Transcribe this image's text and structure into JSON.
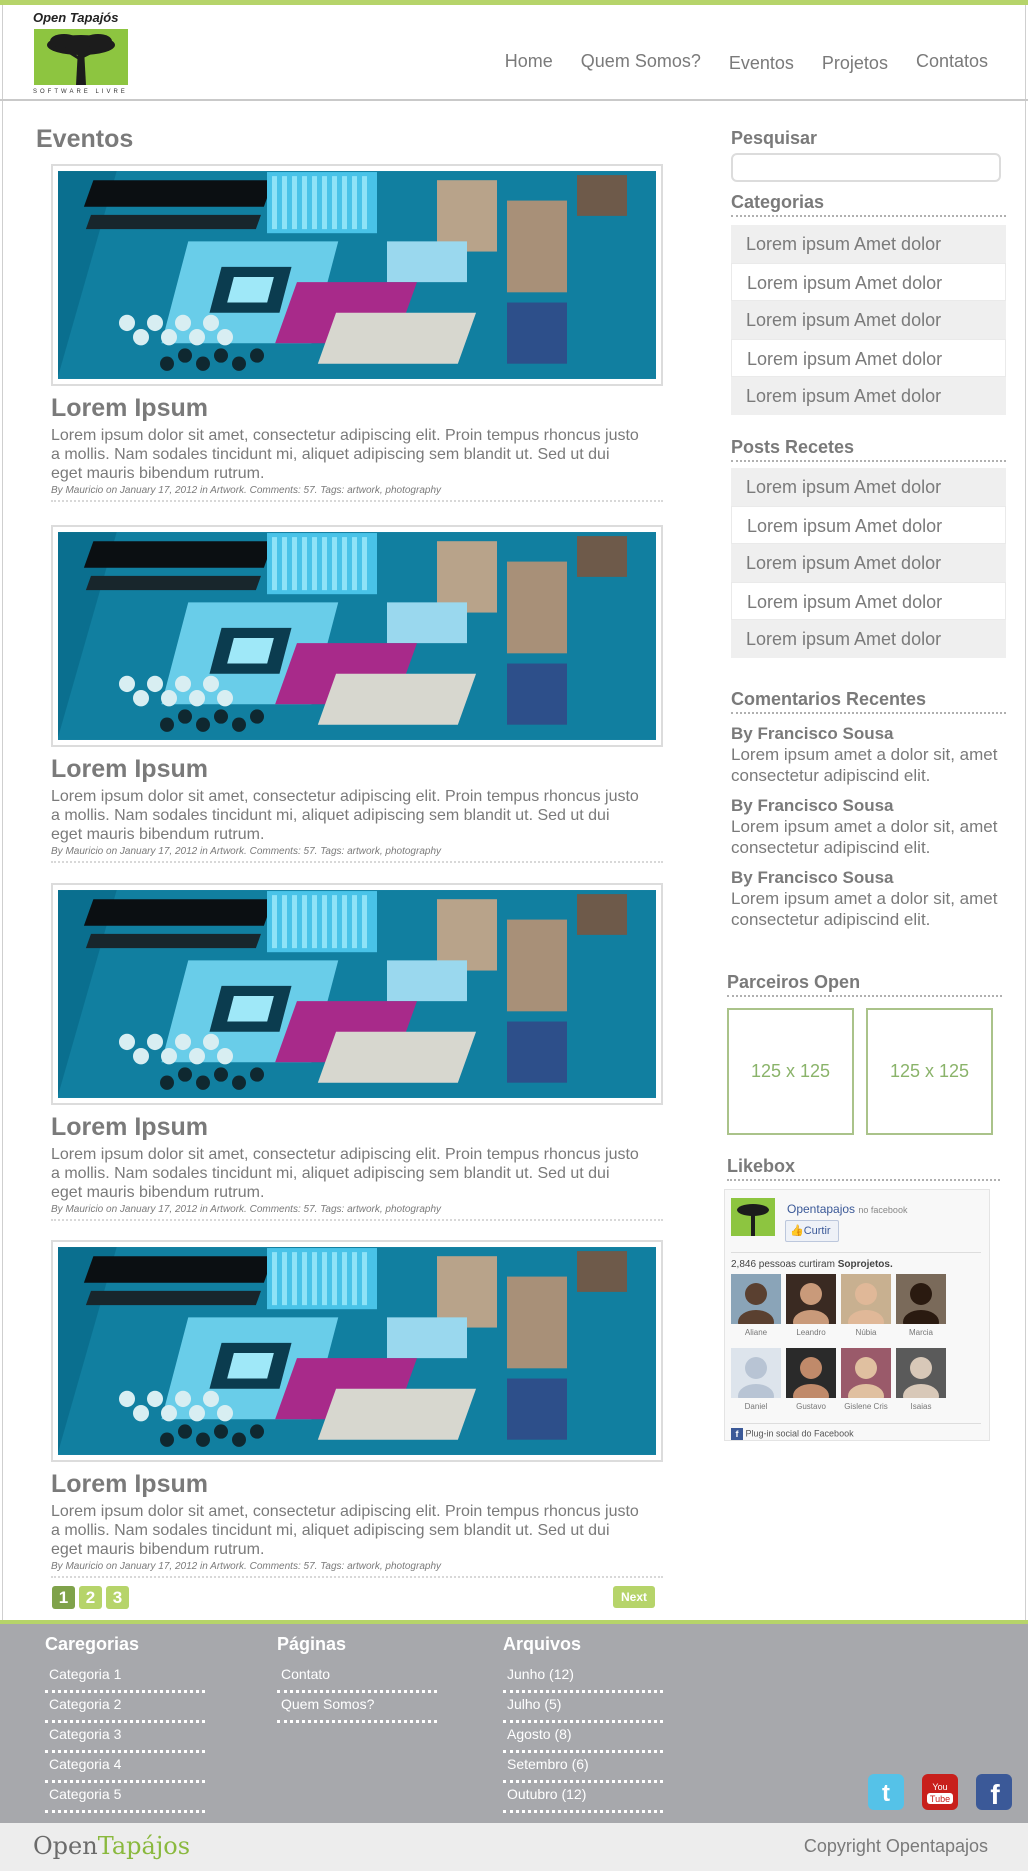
{
  "header": {
    "logo_title": "Open Tapajós",
    "logo_subtitle": "SOFTWARE LIVRE",
    "nav": [
      "Home",
      "Quem Somos?",
      "Eventos",
      "Projetos",
      "Contatos"
    ]
  },
  "main": {
    "title": "Eventos",
    "posts": [
      {
        "title": "Lorem Ipsum",
        "body": "Lorem ipsum dolor sit amet, consectetur adipiscing elit. Proin tempus rhoncus justo a mollis. Nam sodales tincidunt mi, aliquet adipiscing sem blandit ut. Sed ut dui eget mauris bibendum rutrum.",
        "meta": "By Mauricio on January 17, 2012 in Artwork. Comments: 57. Tags: artwork, photography"
      },
      {
        "title": "Lorem Ipsum",
        "body": "Lorem ipsum dolor sit amet, consectetur adipiscing elit. Proin tempus rhoncus justo a mollis. Nam sodales tincidunt mi, aliquet adipiscing sem blandit ut. Sed ut dui eget mauris bibendum rutrum.",
        "meta": "By Mauricio on January 17, 2012 in Artwork. Comments: 57. Tags: artwork, photography"
      },
      {
        "title": "Lorem Ipsum",
        "body": "Lorem ipsum dolor sit amet, consectetur adipiscing elit. Proin tempus rhoncus justo a mollis. Nam sodales tincidunt mi, aliquet adipiscing sem blandit ut. Sed ut dui eget mauris bibendum rutrum.",
        "meta": "By Mauricio on January 17, 2012 in Artwork. Comments: 57. Tags: artwork, photography"
      },
      {
        "title": "Lorem Ipsum",
        "body": "Lorem ipsum dolor sit amet, consectetur adipiscing elit. Proin tempus rhoncus justo a mollis. Nam sodales tincidunt mi, aliquet adipiscing sem blandit ut. Sed ut dui eget mauris bibendum rutrum.",
        "meta": "By Mauricio on January 17, 2012 in Artwork. Comments: 57. Tags: artwork, photography"
      }
    ],
    "pager": [
      "1",
      "2",
      "3"
    ],
    "next_label": "Next"
  },
  "sidebar": {
    "search_title": "Pesquisar",
    "categories_title": "Categorias",
    "categories": [
      "Lorem ipsum Amet dolor",
      "Lorem ipsum Amet dolor",
      "Lorem ipsum Amet dolor",
      "Lorem ipsum Amet dolor",
      "Lorem ipsum Amet dolor"
    ],
    "recent_title": "Posts Recetes",
    "recent": [
      "Lorem ipsum Amet dolor",
      "Lorem ipsum Amet dolor",
      "Lorem ipsum Amet dolor",
      "Lorem ipsum Amet dolor",
      "Lorem ipsum Amet dolor"
    ],
    "comments_title": "Comentarios Recentes",
    "comments": [
      {
        "author": "By Francisco Sousa",
        "text": "Lorem ipsum amet a dolor sit, amet consectetur adipiscind elit."
      },
      {
        "author": "By Francisco Sousa",
        "text": "Lorem ipsum amet a dolor sit, amet consectetur adipiscind elit."
      },
      {
        "author": "By Francisco Sousa",
        "text": "Lorem ipsum amet a dolor sit, amet consectetur adipiscind elit."
      }
    ],
    "partners_title": "Parceiros Open",
    "ads": [
      "125 x 125",
      "125 x 125"
    ],
    "likebox_title": "Likebox",
    "likebox": {
      "page_name": "Opentapajos",
      "on_fb": "no facebook",
      "like_label": "Curtir",
      "count_text": "2,846 pessoas curtiram",
      "count_page": "Soprojetos.",
      "fans": [
        "Aliane",
        "Leandro",
        "Núbia",
        "Marcia",
        "Daniel",
        "Gustavo",
        "Gislene Cris",
        "Isaias"
      ],
      "plugin_text": "Plug-in social do Facebook"
    }
  },
  "footer": {
    "col1_title": "Caregorias",
    "col1": [
      "Categoria 1",
      "Categoria 2",
      "Categoria 3",
      "Categoria 4",
      "Categoria 5"
    ],
    "col2_title": "Páginas",
    "col2": [
      "Contato",
      "Quem Somos?"
    ],
    "col3_title": "Arquivos",
    "col3": [
      "Junho (12)",
      "Julho (5)",
      "Agosto (8)",
      "Setembro (6)",
      "Outubro (12)"
    ],
    "social": [
      "twitter-icon",
      "youtube-icon",
      "facebook-icon"
    ],
    "brand_left": "Open",
    "brand_right": "Tapájos",
    "copyright": "Copyright Opentapajos"
  },
  "colors": {
    "accent": "#b6d46a",
    "footer_bg": "#a7a8ac",
    "text": "#7a7a7a"
  }
}
